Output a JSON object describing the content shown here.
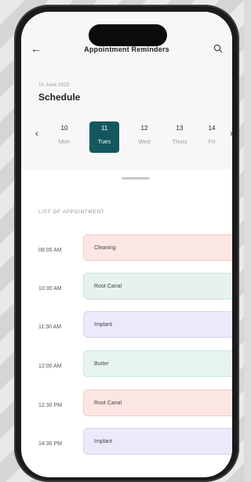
{
  "header": {
    "title": "Appointment Reminders",
    "back_icon": "arrow-left-icon",
    "search_icon": "search-icon"
  },
  "schedule": {
    "date_label": "10 June 2023",
    "title": "Schedule"
  },
  "days": [
    {
      "num": "10",
      "name": "Mon",
      "active": false
    },
    {
      "num": "11",
      "name": "Tues",
      "active": true
    },
    {
      "num": "12",
      "name": "Wed",
      "active": false
    },
    {
      "num": "13",
      "name": "Thurs",
      "active": false
    },
    {
      "num": "14",
      "name": "Fri",
      "active": false
    }
  ],
  "list": {
    "title": "LIST OF APPOINTMENT"
  },
  "appointments": [
    {
      "time": "08:00 AM",
      "label": "Cleaning",
      "color": "#fce6e4",
      "border": "#f0c9c4"
    },
    {
      "time": "10:30 AM",
      "label": "Root Canal",
      "color": "#e6f2f0",
      "border": "#c8e0dc"
    },
    {
      "time": "11:30 AM",
      "label": "Implant",
      "color": "#ece9fb",
      "border": "#d6d1f2"
    },
    {
      "time": "12:00 AM",
      "label": "Butter",
      "color": "#e5f4ee",
      "border": "#c9e6da"
    },
    {
      "time": "12:30 PM",
      "label": "Root Canal",
      "color": "#fce6e4",
      "border": "#f0c9c4"
    },
    {
      "time": "14:30 PM",
      "label": "Implant",
      "color": "#ece9fb",
      "border": "#d6d1f2"
    }
  ],
  "colors": {
    "accent": "#13585f"
  }
}
